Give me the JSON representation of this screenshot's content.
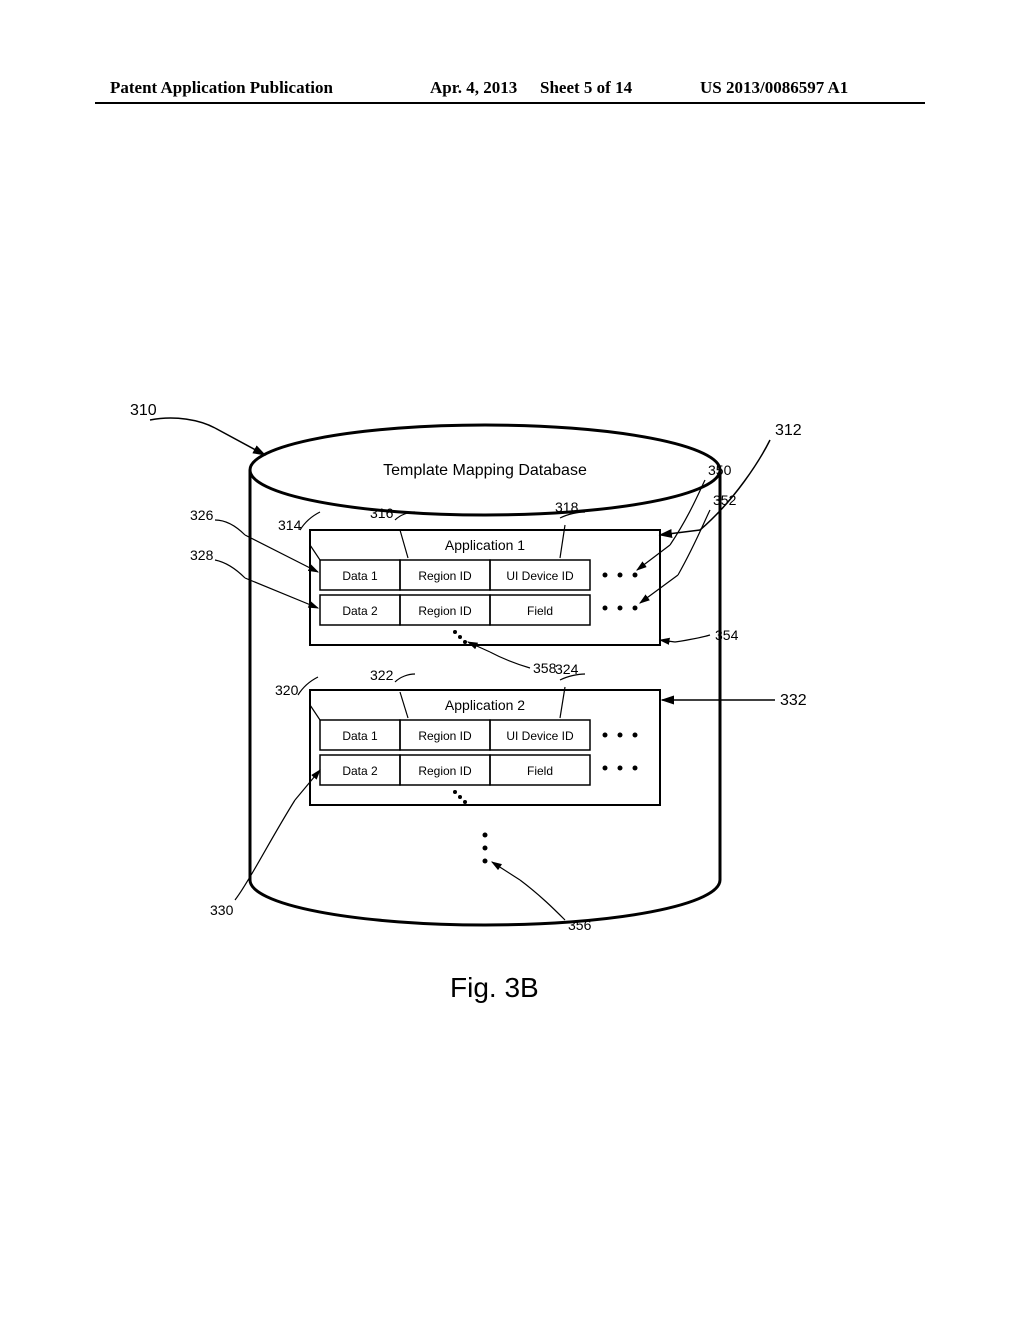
{
  "header": {
    "left": "Patent Application Publication",
    "date": "Apr. 4, 2013",
    "sheet": "Sheet 5 of 14",
    "pubno": "US 2013/0086597 A1"
  },
  "figure": {
    "caption": "Fig. 3B",
    "db_title": "Template Mapping Database",
    "app1": {
      "title": "Application 1",
      "row1": {
        "c1": "Data 1",
        "c2": "Region ID",
        "c3": "UI Device ID"
      },
      "row2": {
        "c1": "Data 2",
        "c2": "Region ID",
        "c3": "Field"
      }
    },
    "app2": {
      "title": "Application 2",
      "row1": {
        "c1": "Data 1",
        "c2": "Region ID",
        "c3": "UI Device ID"
      },
      "row2": {
        "c1": "Data 2",
        "c2": "Region ID",
        "c3": "Field"
      }
    },
    "refs": {
      "n310": "310",
      "n312": "312",
      "n314": "314",
      "n316": "316",
      "n318": "318",
      "n320": "320",
      "n322": "322",
      "n324": "324",
      "n326": "326",
      "n328": "328",
      "n330": "330",
      "n332": "332",
      "n350": "350",
      "n352": "352",
      "n354": "354",
      "n356": "356",
      "n358": "358"
    }
  }
}
